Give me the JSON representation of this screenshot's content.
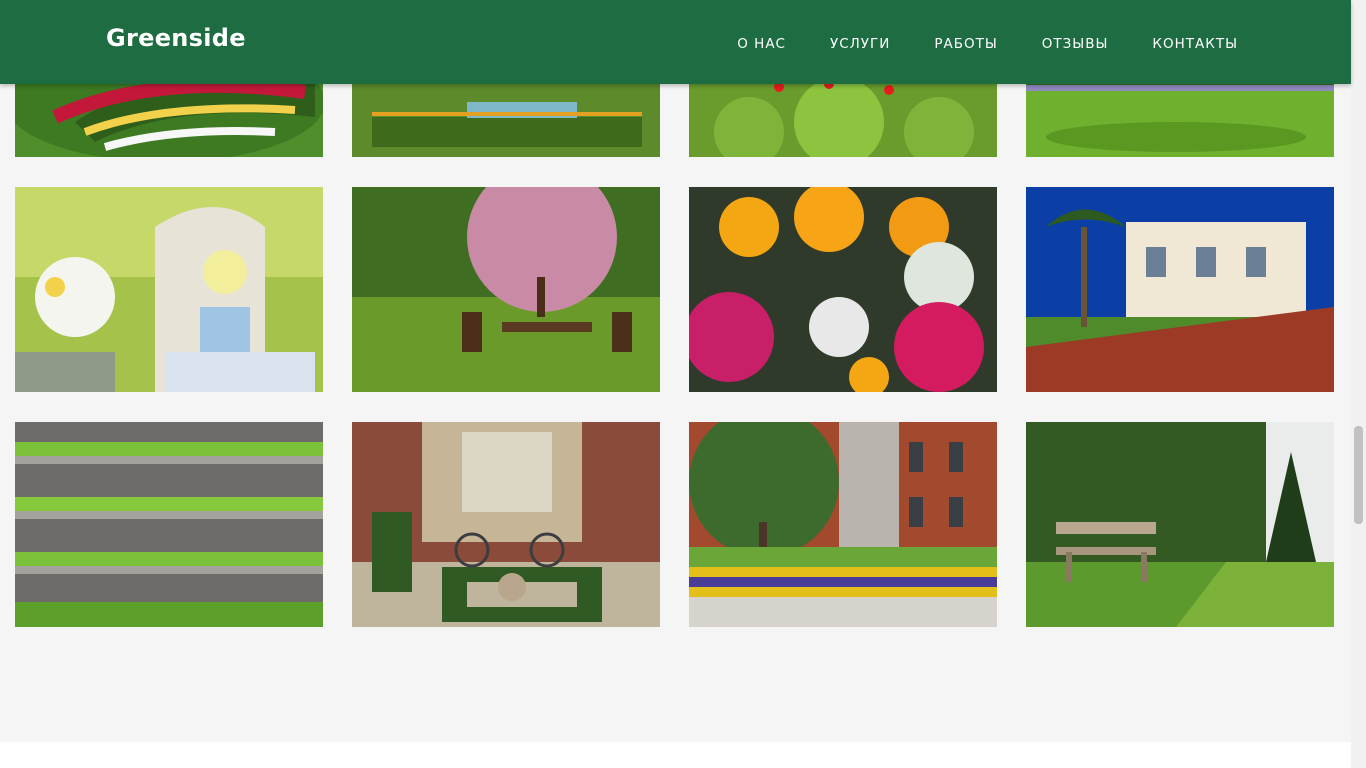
{
  "header": {
    "brand": "Greenside",
    "nav": [
      {
        "label": "О НАС"
      },
      {
        "label": "УСЛУГИ"
      },
      {
        "label": "РАБОТЫ"
      },
      {
        "label": "ОТЗЫВЫ"
      },
      {
        "label": "КОНТАКТЫ"
      }
    ]
  },
  "gallery": {
    "photos": [
      {
        "subject": "flower-bed"
      },
      {
        "subject": "formal-garden-pool"
      },
      {
        "subject": "red-flowers-hedge"
      },
      {
        "subject": "park-lawn"
      },
      {
        "subject": "daisies-on-chair"
      },
      {
        "subject": "garden-table-tree"
      },
      {
        "subject": "marigolds-bouquet"
      },
      {
        "subject": "villa-palm-trees"
      },
      {
        "subject": "green-balconies"
      },
      {
        "subject": "bicycle-hedge-garden"
      },
      {
        "subject": "brick-building-flowerbed"
      },
      {
        "subject": "bench-garden-path"
      }
    ]
  },
  "colors": {
    "header_bg": "#1e6d42",
    "page_bg": "#f5f5f5"
  }
}
